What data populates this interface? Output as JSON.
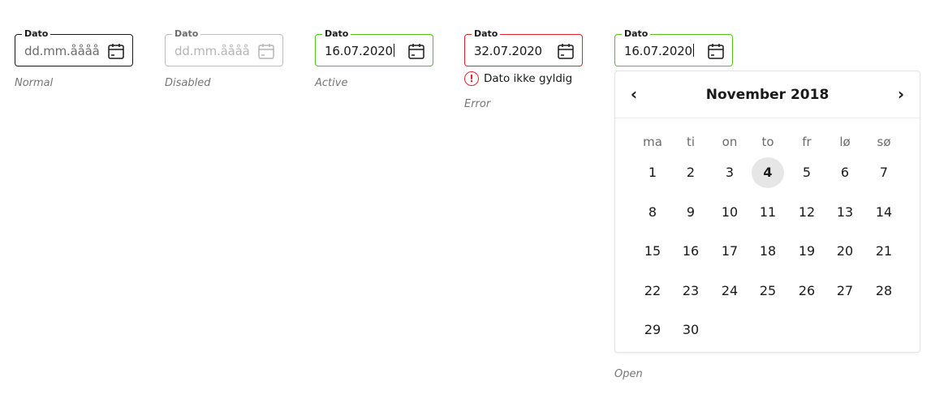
{
  "inputs": [
    {
      "label": "Dato",
      "value": "dd.mm.åååå",
      "caption": "Normal"
    },
    {
      "label": "Dato",
      "value": "dd.mm.åååå",
      "caption": "Disabled"
    },
    {
      "label": "Dato",
      "value": "16.07.2020",
      "caption": "Active"
    },
    {
      "label": "Dato",
      "value": "32.07.2020",
      "caption": "Error",
      "error_message": "Dato ikke gyldig"
    },
    {
      "label": "Dato",
      "value": "16.07.2020",
      "caption": "Open"
    }
  ],
  "colors": {
    "active_border": "#52c41a",
    "error": "#e0262b",
    "today_bg": "#e6e6e6"
  },
  "icons": {
    "calendar": "calendar-icon",
    "error": "error-icon",
    "prev": "chevron-left-icon",
    "next": "chevron-right-icon"
  },
  "datepicker": {
    "month_label": "November 2018",
    "weekdays": [
      "ma",
      "ti",
      "on",
      "to",
      "fr",
      "lø",
      "sø"
    ],
    "days": [
      "1",
      "2",
      "3",
      "4",
      "5",
      "6",
      "7",
      "8",
      "9",
      "10",
      "11",
      "12",
      "13",
      "14",
      "15",
      "16",
      "17",
      "18",
      "19",
      "20",
      "21",
      "22",
      "23",
      "24",
      "25",
      "26",
      "27",
      "28",
      "29",
      "30"
    ],
    "first_weekday_index": 0,
    "highlighted_day": "4"
  }
}
